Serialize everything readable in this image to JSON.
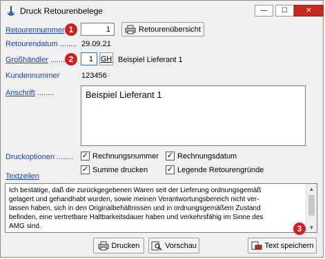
{
  "window": {
    "title": "Druck Retourenbelege",
    "minimize_glyph": "—",
    "maximize_glyph": "☐",
    "close_glyph": "✕"
  },
  "fields": {
    "retourennummer": {
      "label": "Retourennummer",
      "value": "1"
    },
    "retourendatum": {
      "label": "Retourendatum",
      "value": "29.09.21"
    },
    "grosshaendler": {
      "label": "Großhändler",
      "value": "1",
      "button": "GH",
      "name": "Beispiel Lieferant 1"
    },
    "kundennummer": {
      "label": "Kundennummer",
      "value": "123456"
    },
    "anschrift": {
      "label": "Anschrift",
      "value": "Beispiel Lieferant 1"
    }
  },
  "retourenuebersicht_button": "Retourenübersicht",
  "druckoptionen": {
    "label": "Druckoptionen",
    "options": [
      {
        "label": "Rechnungsnummer",
        "checked": true
      },
      {
        "label": "Rechnungsdatum",
        "checked": true
      },
      {
        "label": "Summe drucken",
        "checked": true
      },
      {
        "label": "Legende Retourengründe",
        "checked": true
      }
    ]
  },
  "textzeilen": {
    "label": "Textzeilen",
    "text": "Ich bestätige, daß die zurückgegebenen Waren seit der Lieferung ordnungsgemäß\ngelagert und gehandhabt wurden, sowie meinen Verantwortungsbereich nicht ver-\nlassen haben, sich in den Originalbehältnissen und in ordnungsgemäßem Zustand\nbefinden, eine vertretbare Haltbarkeitsdauer haben und verkehrsfähig im Sinne des\nAMG sind."
  },
  "buttons": {
    "drucken": "Drucken",
    "vorschau": "Vorschau",
    "text_speichern": "Text speichern"
  },
  "badges": [
    "1",
    "2",
    "3"
  ],
  "dots": "........",
  "check_glyph": "✓",
  "colors": {
    "label_blue": "#1a3fb5",
    "badge_red": "#d01f1f",
    "close_red": "#c42b1c"
  }
}
